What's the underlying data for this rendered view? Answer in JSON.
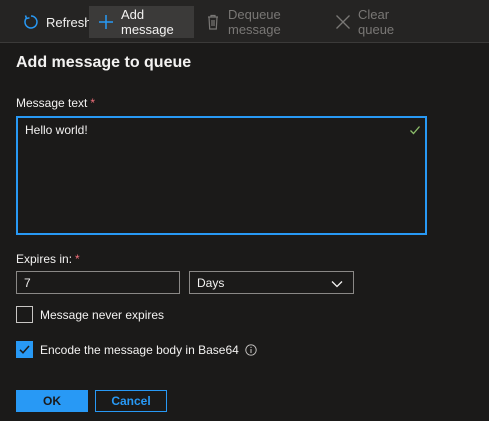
{
  "toolbar": {
    "refresh": "Refresh",
    "add_message": "Add message",
    "dequeue_message": "Dequeue message",
    "clear_queue": "Clear queue"
  },
  "panel": {
    "title": "Add message to queue",
    "message_text_label": "Message text",
    "message_text_value": "Hello world!",
    "required_marker": "*",
    "expires_label": "Expires in:",
    "expires_value": "7",
    "expires_unit": "Days",
    "never_expires_label": "Message never expires",
    "never_expires_checked": false,
    "encode_label": "Encode the message body in Base64",
    "encode_checked": true
  },
  "buttons": {
    "ok": "OK",
    "cancel": "Cancel"
  },
  "colors": {
    "accent": "#2899f5",
    "background": "#1b1a19",
    "required": "#f1707b",
    "valid_check": "#8cbd6a"
  },
  "icons": {
    "refresh": "refresh-icon",
    "add": "plus-icon",
    "dequeue": "trash-icon",
    "clear": "close-icon",
    "valid": "checkmark-icon",
    "dropdown": "chevron-down-icon",
    "info": "info-icon"
  }
}
